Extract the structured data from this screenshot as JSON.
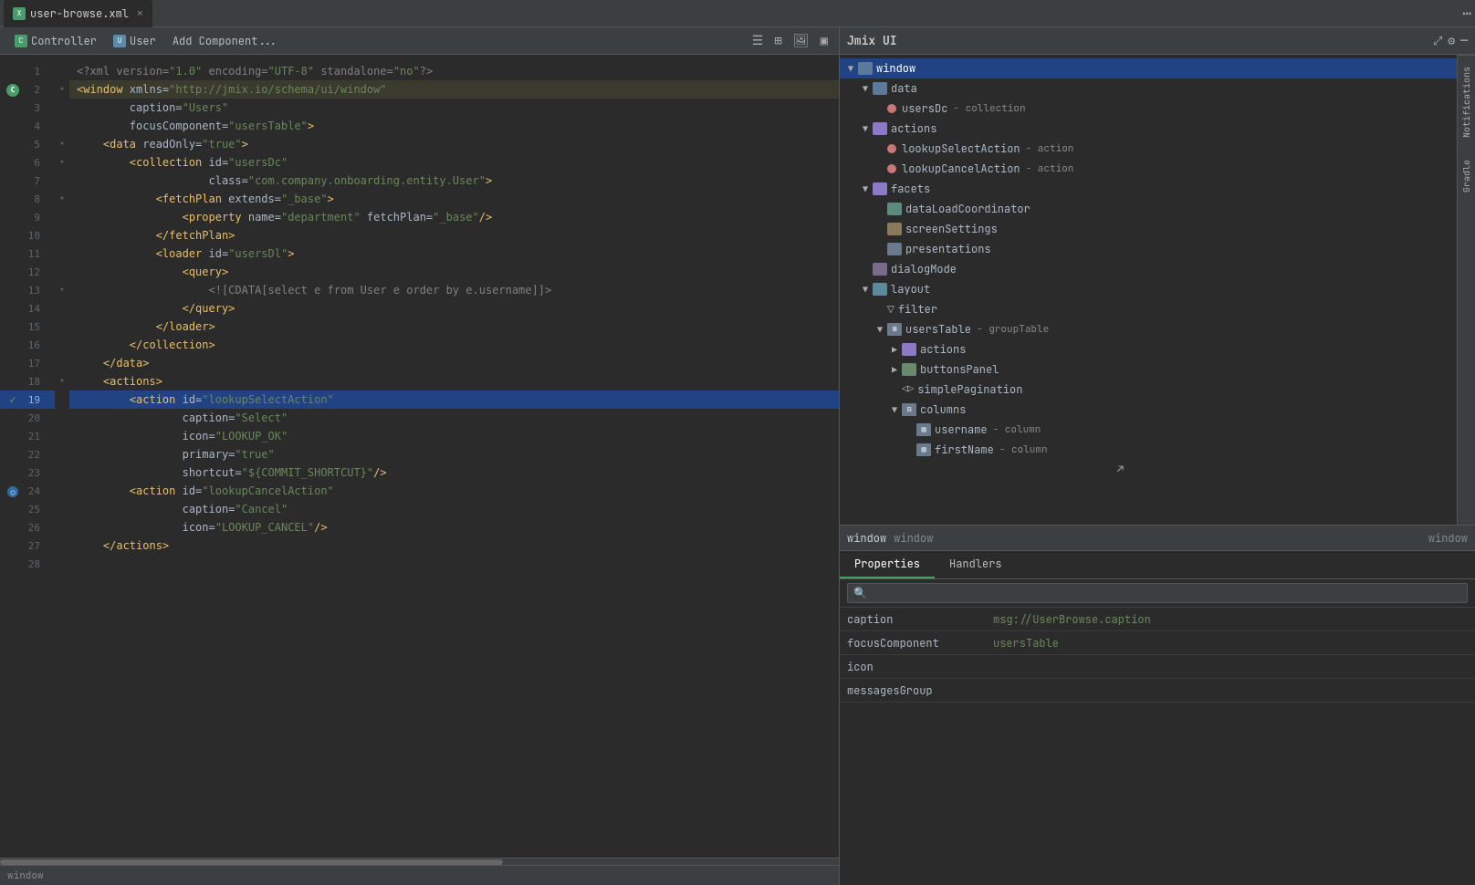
{
  "app": {
    "title": "Jmix UI"
  },
  "editor": {
    "tab": {
      "name": "user-browse.xml",
      "icon": "xml-file-icon"
    },
    "toolbar": {
      "tabs": [
        "Controller",
        "User",
        "Add Component..."
      ]
    },
    "lines": [
      {
        "num": 1,
        "gutter": "",
        "indent": 0,
        "content": "<?xml version=\"1.0\" encoding=\"UTF-8\" standalone=\"no\"?>",
        "type": "xml-decl"
      },
      {
        "num": 2,
        "gutter": "C",
        "indent": 0,
        "content": "<window xmlns=\"http://jmix.io/schema/ui/window\"",
        "type": "tag-open",
        "highlighted": true
      },
      {
        "num": 3,
        "gutter": "",
        "indent": 1,
        "content": "caption=\"Users\"",
        "type": "attr"
      },
      {
        "num": 4,
        "gutter": "",
        "indent": 1,
        "content": "focusComponent=\"usersTable\">",
        "type": "attr"
      },
      {
        "num": 5,
        "gutter": "",
        "indent": 1,
        "content": "<data readOnly=\"true\">",
        "type": "tag"
      },
      {
        "num": 6,
        "gutter": "",
        "indent": 2,
        "content": "<collection id=\"usersDc\"",
        "type": "tag"
      },
      {
        "num": 7,
        "gutter": "",
        "indent": 3,
        "content": "class=\"com.company.onboarding.entity.User\">",
        "type": "attr"
      },
      {
        "num": 8,
        "gutter": "",
        "indent": 3,
        "content": "<fetchPlan extends=\"_base\">",
        "type": "tag"
      },
      {
        "num": 9,
        "gutter": "",
        "indent": 4,
        "content": "<property name=\"department\" fetchPlan=\"_base\"/>",
        "type": "tag"
      },
      {
        "num": 10,
        "gutter": "",
        "indent": 3,
        "content": "</fetchPlan>",
        "type": "tag"
      },
      {
        "num": 11,
        "gutter": "",
        "indent": 3,
        "content": "<loader id=\"usersDl\">",
        "type": "tag"
      },
      {
        "num": 12,
        "gutter": "",
        "indent": 4,
        "content": "<query>",
        "type": "tag"
      },
      {
        "num": 13,
        "gutter": "",
        "indent": 5,
        "content": "<![CDATA[select e from User e order by e.username]]>",
        "type": "cdata"
      },
      {
        "num": 14,
        "gutter": "",
        "indent": 4,
        "content": "</query>",
        "type": "tag"
      },
      {
        "num": 15,
        "gutter": "",
        "indent": 3,
        "content": "</loader>",
        "type": "tag"
      },
      {
        "num": 16,
        "gutter": "",
        "indent": 2,
        "content": "</collection>",
        "type": "tag"
      },
      {
        "num": 17,
        "gutter": "",
        "indent": 1,
        "content": "</data>",
        "type": "tag"
      },
      {
        "num": 18,
        "gutter": "",
        "indent": 1,
        "content": "<actions>",
        "type": "tag"
      },
      {
        "num": 19,
        "gutter": "✓",
        "indent": 2,
        "content": "<action id=\"lookupSelectAction\"",
        "type": "tag",
        "selected": true
      },
      {
        "num": 20,
        "gutter": "",
        "indent": 3,
        "content": "caption=\"Select\"",
        "type": "attr"
      },
      {
        "num": 21,
        "gutter": "",
        "indent": 3,
        "content": "icon=\"LOOKUP_OK\"",
        "type": "attr"
      },
      {
        "num": 22,
        "gutter": "",
        "indent": 3,
        "content": "primary=\"true\"",
        "type": "attr"
      },
      {
        "num": 23,
        "gutter": "",
        "indent": 3,
        "content": "shortcut=\"${COMMIT_SHORTCUT}\"/>",
        "type": "attr"
      },
      {
        "num": 24,
        "gutter": "○",
        "indent": 2,
        "content": "<action id=\"lookupCancelAction\"",
        "type": "tag"
      },
      {
        "num": 25,
        "gutter": "",
        "indent": 3,
        "content": "caption=\"Cancel\"",
        "type": "attr"
      },
      {
        "num": 26,
        "gutter": "",
        "indent": 3,
        "content": "icon=\"LOOKUP_CANCEL\"/>",
        "type": "attr"
      },
      {
        "num": 27,
        "gutter": "",
        "indent": 1,
        "content": "</actions>",
        "type": "tag"
      },
      {
        "num": 28,
        "gutter": "",
        "indent": 0,
        "content": "",
        "type": "blank"
      }
    ]
  },
  "jmix_panel": {
    "title": "Jmix UI",
    "tree": {
      "items": [
        {
          "id": "window",
          "label": "window",
          "sub": "",
          "indent": 0,
          "arrow": "▼",
          "icon": "window",
          "selected": true
        },
        {
          "id": "data",
          "label": "data",
          "sub": "",
          "indent": 1,
          "arrow": "▼",
          "icon": "data"
        },
        {
          "id": "usersDc",
          "label": "usersDc",
          "sub": "collection",
          "indent": 2,
          "arrow": "",
          "icon": "collection"
        },
        {
          "id": "actions",
          "label": "actions",
          "sub": "",
          "indent": 1,
          "arrow": "▼",
          "icon": "actions"
        },
        {
          "id": "lookupSelectAction",
          "label": "lookupSelectAction",
          "sub": "action",
          "indent": 2,
          "arrow": "",
          "icon": "action"
        },
        {
          "id": "lookupCancelAction",
          "label": "lookupCancelAction",
          "sub": "action",
          "indent": 2,
          "arrow": "",
          "icon": "action"
        },
        {
          "id": "facets",
          "label": "facets",
          "sub": "",
          "indent": 1,
          "arrow": "▼",
          "icon": "facets"
        },
        {
          "id": "dataLoadCoordinator",
          "label": "dataLoadCoordinator",
          "sub": "",
          "indent": 2,
          "arrow": "",
          "icon": "coord"
        },
        {
          "id": "screenSettings",
          "label": "screenSettings",
          "sub": "",
          "indent": 2,
          "arrow": "",
          "icon": "screen"
        },
        {
          "id": "presentations",
          "label": "presentations",
          "sub": "",
          "indent": 2,
          "arrow": "",
          "icon": "pres"
        },
        {
          "id": "dialogMode",
          "label": "dialogMode",
          "sub": "",
          "indent": 1,
          "arrow": "",
          "icon": "dialog"
        },
        {
          "id": "layout",
          "label": "layout",
          "sub": "",
          "indent": 1,
          "arrow": "▼",
          "icon": "layout"
        },
        {
          "id": "filter",
          "label": "filter",
          "sub": "",
          "indent": 2,
          "arrow": "",
          "icon": "filter"
        },
        {
          "id": "usersTable",
          "label": "usersTable",
          "sub": "groupTable",
          "indent": 2,
          "arrow": "▼",
          "icon": "table"
        },
        {
          "id": "actions2",
          "label": "actions",
          "sub": "",
          "indent": 3,
          "arrow": "▶",
          "icon": "actions"
        },
        {
          "id": "buttonsPanel",
          "label": "buttonsPanel",
          "sub": "",
          "indent": 3,
          "arrow": "▶",
          "icon": "buttons"
        },
        {
          "id": "simplePagination",
          "label": "simplePagination",
          "sub": "",
          "indent": 3,
          "arrow": "",
          "icon": "pagination"
        },
        {
          "id": "columns",
          "label": "columns",
          "sub": "",
          "indent": 3,
          "arrow": "▼",
          "icon": "columns"
        },
        {
          "id": "username",
          "label": "username",
          "sub": "column",
          "indent": 4,
          "arrow": "",
          "icon": "column"
        },
        {
          "id": "firstName",
          "label": "firstName",
          "sub": "column",
          "indent": 4,
          "arrow": "",
          "icon": "column"
        }
      ]
    },
    "properties": {
      "selected_element": "window",
      "selected_type": "window",
      "tabs": [
        "Properties",
        "Handlers"
      ],
      "active_tab": "Properties",
      "search_placeholder": "🔍",
      "rows": [
        {
          "key": "caption",
          "value": "msg://UserBrowse.caption"
        },
        {
          "key": "focusComponent",
          "value": "usersTable"
        },
        {
          "key": "icon",
          "value": ""
        },
        {
          "key": "messagesGroup",
          "value": ""
        }
      ]
    }
  },
  "status_bar": {
    "text": "window"
  },
  "side_tabs": [
    "Notifications",
    "Gradle"
  ]
}
